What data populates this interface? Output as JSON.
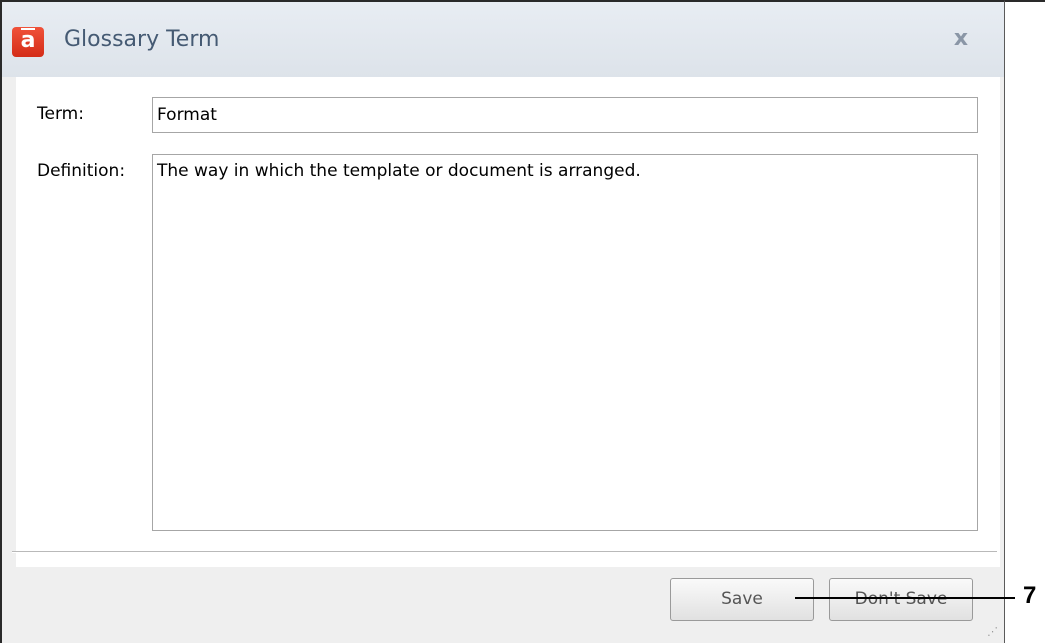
{
  "window": {
    "title": "Glossary Term",
    "close_glyph": "x"
  },
  "form": {
    "term_label": "Term:",
    "term_value": "Format",
    "definition_label": "Definition:",
    "definition_value": "The way in which the template or document is arranged."
  },
  "buttons": {
    "save_label": "Save",
    "dont_save_label": "Don't Save"
  },
  "callout": {
    "number": "7"
  },
  "icons": {
    "app": "adobe-captivate-icon",
    "close": "close-icon",
    "resize": "resize-grip-icon"
  },
  "colors": {
    "app_icon": "#d42c17",
    "title_text": "#455a73"
  }
}
